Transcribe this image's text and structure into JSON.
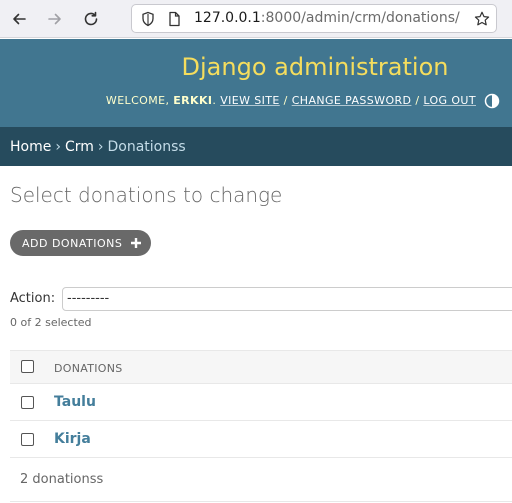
{
  "browser": {
    "url_host": "127.0.0.1",
    "url_rest": ":8000/admin/crm/donations/"
  },
  "header": {
    "brand": "Django administration",
    "welcome": "Welcome,",
    "username": "Erkki",
    "view_site": "View site",
    "change_password": "Change password",
    "log_out": "Log out",
    "separator": " / "
  },
  "breadcrumbs": {
    "home": "Home",
    "app": "Crm",
    "current": "Donationss",
    "separator": "›"
  },
  "content": {
    "title": "Select donations to change",
    "add_button": "Add donations",
    "action_label": "Action:",
    "action_value": "---------",
    "selection_counter": "0 of 2 selected",
    "column_header": "Donations",
    "rows": [
      {
        "label": "Taulu"
      },
      {
        "label": "Kirja"
      }
    ],
    "result_count": "2 donationss"
  },
  "colors": {
    "header_bg": "#417690",
    "brand": "#f5dd5d",
    "breadcrumb_bg": "#264b5d",
    "link": "#447e9b"
  }
}
